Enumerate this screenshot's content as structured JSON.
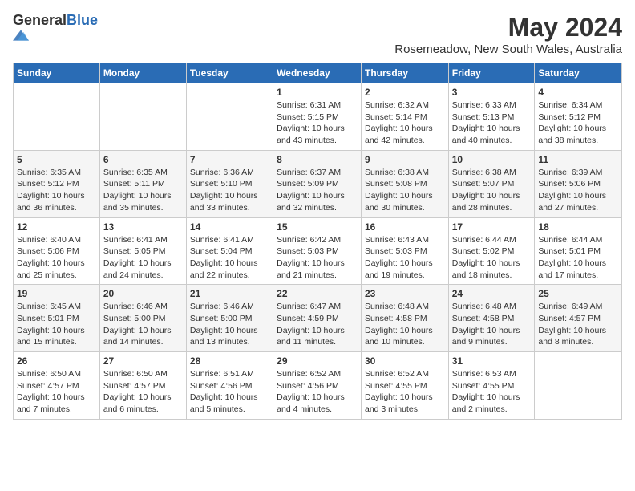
{
  "logo": {
    "general": "General",
    "blue": "Blue"
  },
  "title": "May 2024",
  "location": "Rosemeadow, New South Wales, Australia",
  "headers": [
    "Sunday",
    "Monday",
    "Tuesday",
    "Wednesday",
    "Thursday",
    "Friday",
    "Saturday"
  ],
  "weeks": [
    [
      {
        "day": "",
        "info": ""
      },
      {
        "day": "",
        "info": ""
      },
      {
        "day": "",
        "info": ""
      },
      {
        "day": "1",
        "info": "Sunrise: 6:31 AM\nSunset: 5:15 PM\nDaylight: 10 hours\nand 43 minutes."
      },
      {
        "day": "2",
        "info": "Sunrise: 6:32 AM\nSunset: 5:14 PM\nDaylight: 10 hours\nand 42 minutes."
      },
      {
        "day": "3",
        "info": "Sunrise: 6:33 AM\nSunset: 5:13 PM\nDaylight: 10 hours\nand 40 minutes."
      },
      {
        "day": "4",
        "info": "Sunrise: 6:34 AM\nSunset: 5:12 PM\nDaylight: 10 hours\nand 38 minutes."
      }
    ],
    [
      {
        "day": "5",
        "info": "Sunrise: 6:35 AM\nSunset: 5:12 PM\nDaylight: 10 hours\nand 36 minutes."
      },
      {
        "day": "6",
        "info": "Sunrise: 6:35 AM\nSunset: 5:11 PM\nDaylight: 10 hours\nand 35 minutes."
      },
      {
        "day": "7",
        "info": "Sunrise: 6:36 AM\nSunset: 5:10 PM\nDaylight: 10 hours\nand 33 minutes."
      },
      {
        "day": "8",
        "info": "Sunrise: 6:37 AM\nSunset: 5:09 PM\nDaylight: 10 hours\nand 32 minutes."
      },
      {
        "day": "9",
        "info": "Sunrise: 6:38 AM\nSunset: 5:08 PM\nDaylight: 10 hours\nand 30 minutes."
      },
      {
        "day": "10",
        "info": "Sunrise: 6:38 AM\nSunset: 5:07 PM\nDaylight: 10 hours\nand 28 minutes."
      },
      {
        "day": "11",
        "info": "Sunrise: 6:39 AM\nSunset: 5:06 PM\nDaylight: 10 hours\nand 27 minutes."
      }
    ],
    [
      {
        "day": "12",
        "info": "Sunrise: 6:40 AM\nSunset: 5:06 PM\nDaylight: 10 hours\nand 25 minutes."
      },
      {
        "day": "13",
        "info": "Sunrise: 6:41 AM\nSunset: 5:05 PM\nDaylight: 10 hours\nand 24 minutes."
      },
      {
        "day": "14",
        "info": "Sunrise: 6:41 AM\nSunset: 5:04 PM\nDaylight: 10 hours\nand 22 minutes."
      },
      {
        "day": "15",
        "info": "Sunrise: 6:42 AM\nSunset: 5:03 PM\nDaylight: 10 hours\nand 21 minutes."
      },
      {
        "day": "16",
        "info": "Sunrise: 6:43 AM\nSunset: 5:03 PM\nDaylight: 10 hours\nand 19 minutes."
      },
      {
        "day": "17",
        "info": "Sunrise: 6:44 AM\nSunset: 5:02 PM\nDaylight: 10 hours\nand 18 minutes."
      },
      {
        "day": "18",
        "info": "Sunrise: 6:44 AM\nSunset: 5:01 PM\nDaylight: 10 hours\nand 17 minutes."
      }
    ],
    [
      {
        "day": "19",
        "info": "Sunrise: 6:45 AM\nSunset: 5:01 PM\nDaylight: 10 hours\nand 15 minutes."
      },
      {
        "day": "20",
        "info": "Sunrise: 6:46 AM\nSunset: 5:00 PM\nDaylight: 10 hours\nand 14 minutes."
      },
      {
        "day": "21",
        "info": "Sunrise: 6:46 AM\nSunset: 5:00 PM\nDaylight: 10 hours\nand 13 minutes."
      },
      {
        "day": "22",
        "info": "Sunrise: 6:47 AM\nSunset: 4:59 PM\nDaylight: 10 hours\nand 11 minutes."
      },
      {
        "day": "23",
        "info": "Sunrise: 6:48 AM\nSunset: 4:58 PM\nDaylight: 10 hours\nand 10 minutes."
      },
      {
        "day": "24",
        "info": "Sunrise: 6:48 AM\nSunset: 4:58 PM\nDaylight: 10 hours\nand 9 minutes."
      },
      {
        "day": "25",
        "info": "Sunrise: 6:49 AM\nSunset: 4:57 PM\nDaylight: 10 hours\nand 8 minutes."
      }
    ],
    [
      {
        "day": "26",
        "info": "Sunrise: 6:50 AM\nSunset: 4:57 PM\nDaylight: 10 hours\nand 7 minutes."
      },
      {
        "day": "27",
        "info": "Sunrise: 6:50 AM\nSunset: 4:57 PM\nDaylight: 10 hours\nand 6 minutes."
      },
      {
        "day": "28",
        "info": "Sunrise: 6:51 AM\nSunset: 4:56 PM\nDaylight: 10 hours\nand 5 minutes."
      },
      {
        "day": "29",
        "info": "Sunrise: 6:52 AM\nSunset: 4:56 PM\nDaylight: 10 hours\nand 4 minutes."
      },
      {
        "day": "30",
        "info": "Sunrise: 6:52 AM\nSunset: 4:55 PM\nDaylight: 10 hours\nand 3 minutes."
      },
      {
        "day": "31",
        "info": "Sunrise: 6:53 AM\nSunset: 4:55 PM\nDaylight: 10 hours\nand 2 minutes."
      },
      {
        "day": "",
        "info": ""
      }
    ]
  ]
}
